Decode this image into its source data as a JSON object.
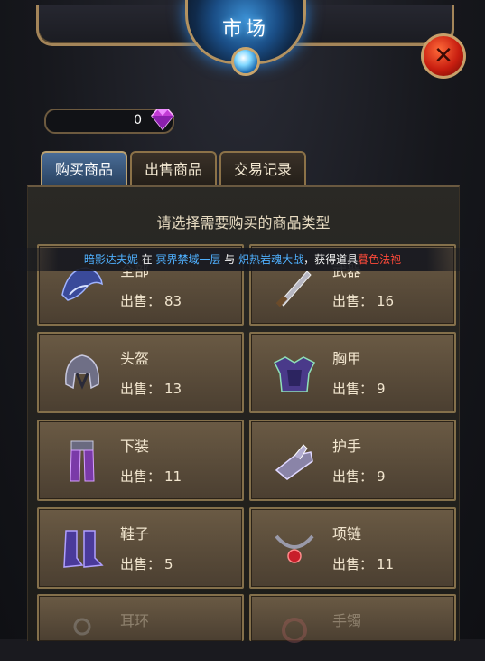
{
  "header": {
    "title": "市场"
  },
  "currency": {
    "amount": "0",
    "icon": "diamond-icon",
    "color": "#c23bd6"
  },
  "tabs": [
    {
      "label": "购买商品",
      "active": true
    },
    {
      "label": "出售商品",
      "active": false
    },
    {
      "label": "交易记录",
      "active": false
    }
  ],
  "panel": {
    "title": "请选择需要购买的商品类型"
  },
  "ticker": {
    "player": "暗影达夫妮",
    "t1": " 在 ",
    "place": "冥界禁域一层",
    "t2": " 与 ",
    "event": "炽热岩魂大战",
    "t3": "，获得道具",
    "item": "暮色法袍"
  },
  "sale_label": "出售：",
  "categories": [
    {
      "name": "全部",
      "count": "83",
      "icon": "shoulder-armor-icon"
    },
    {
      "name": "武器",
      "count": "16",
      "icon": "sword-icon"
    },
    {
      "name": "头盔",
      "count": "13",
      "icon": "helmet-icon"
    },
    {
      "name": "胸甲",
      "count": "9",
      "icon": "chest-armor-icon"
    },
    {
      "name": "下装",
      "count": "11",
      "icon": "leg-armor-icon"
    },
    {
      "name": "护手",
      "count": "9",
      "icon": "gauntlet-icon"
    },
    {
      "name": "鞋子",
      "count": "5",
      "icon": "boots-icon"
    },
    {
      "name": "项链",
      "count": "11",
      "icon": "necklace-icon"
    },
    {
      "name": "耳环",
      "count": "",
      "icon": "earring-icon"
    },
    {
      "name": "手镯",
      "count": "",
      "icon": "bracelet-icon"
    }
  ]
}
